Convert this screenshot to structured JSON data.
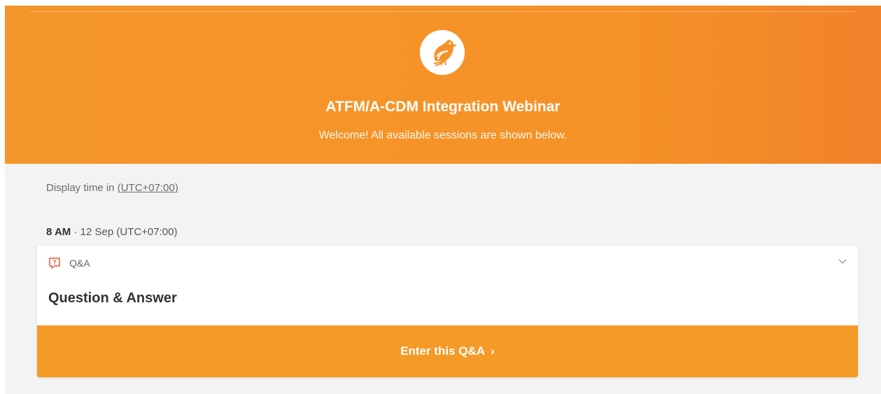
{
  "header": {
    "event_title": "ATFM/A-CDM Integration Webinar",
    "welcome_text": "Welcome! All available sessions are shown below.",
    "logo_icon": "bird-icon",
    "accent_color": "#f5962a"
  },
  "timezone": {
    "prefix": "Display time in",
    "value": "(UTC+07:00)"
  },
  "session_group": {
    "hour": "8 AM",
    "separator": "·",
    "date_text": "12 Sep (UTC+07:00)"
  },
  "session_card": {
    "type_icon": "question-bubble-icon",
    "type_label": "Q&A",
    "title": "Question & Answer",
    "expand_icon": "chevron-down-icon",
    "enter_label": "Enter this Q&A",
    "enter_arrow": "›"
  }
}
